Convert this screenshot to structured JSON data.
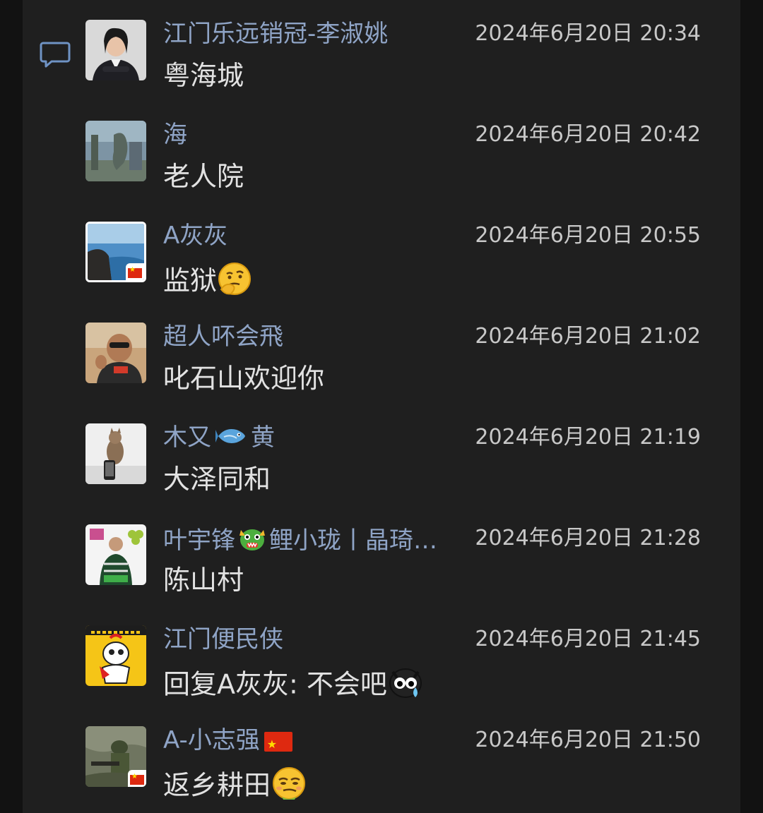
{
  "conversation": {
    "messages": [
      {
        "sender": "江门乐远销冠-李淑姚",
        "time": "2024年6月20日 20:34",
        "text": "粤海城"
      },
      {
        "sender": "海",
        "time": "2024年6月20日 20:42",
        "text": "老人院"
      },
      {
        "sender": "A灰灰",
        "time": "2024年6月20日 20:55",
        "text": "监狱",
        "emoji": "thinking-face"
      },
      {
        "sender": "超人吥会飛",
        "time": "2024年6月20日 21:02",
        "text": "叱石山欢迎你"
      },
      {
        "sender_prefix": "木又",
        "sender_suffix": "黄",
        "sender_emoji": "fish",
        "time": "2024年6月20日 21:19",
        "text": "大泽同和"
      },
      {
        "sender_prefix": "叶宇锋",
        "sender_suffix": "鲤小珑丨晶琦…",
        "sender_emoji": "dragon",
        "time": "2024年6月20日 21:28",
        "text": "陈山村"
      },
      {
        "sender": "江门便民侠",
        "time": "2024年6月20日 21:45",
        "text": "回复A灰灰: 不会吧",
        "emoji": "crying-face"
      },
      {
        "sender": "A-小志强",
        "sender_emoji": "china-flag",
        "time": "2024年6月20日 21:50",
        "text": "返乡耕田",
        "emoji": "smirk-face"
      }
    ]
  },
  "colors": {
    "background": "#121212",
    "panel": "#1f1f1f",
    "sender_name": "#8fa4c6",
    "timestamp": "#c8c8c8",
    "message_text": "#e2e2e2",
    "comment_icon": "#6f93c4"
  }
}
